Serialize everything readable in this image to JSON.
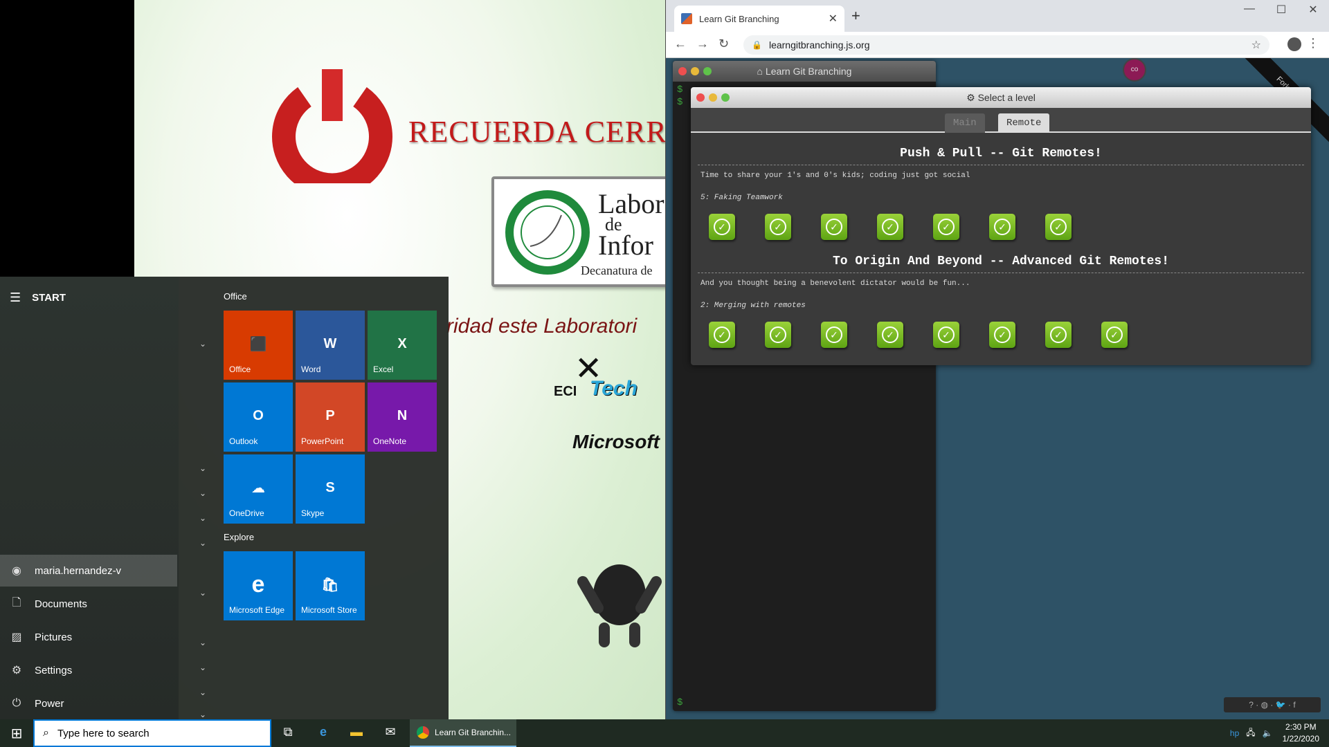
{
  "wallpaper": {
    "recuerda": "RECUERDA CERR",
    "lab_title_line1": "Labor",
    "lab_title_line2": "de",
    "lab_title_line3": "Infor",
    "lab_sub": "Decanatura de",
    "cuidado": "ridad este Laboratori",
    "ecitech": "Tech",
    "eci": "ECI",
    "microsoft": "Microsoft"
  },
  "chrome": {
    "tab_title": "Learn Git Branching",
    "url": "learngitbranching.js.org",
    "terminal_title": "Learn Git Branching",
    "avatar_initials": "co",
    "fork_ribbon": "Fork me",
    "level_window_title": "Select a level",
    "tabs": [
      "Main",
      "Remote"
    ],
    "sequences": [
      {
        "title": "Push & Pull -- Git Remotes!",
        "about": "Time to share your 1's and 0's kids; coding just got social",
        "current": "5: Faking Teamwork",
        "levels_completed": 7
      },
      {
        "title": "To Origin And Beyond -- Advanced Git Remotes!",
        "about": "And you thought being a benevolent dictator would be fun...",
        "current": "2: Merging with remotes",
        "levels_completed": 8
      }
    ]
  },
  "start_menu": {
    "header": "START",
    "user": "maria.hernandez-v",
    "nav": [
      "Documents",
      "Pictures",
      "Settings",
      "Power"
    ],
    "groups": [
      {
        "label": "Office",
        "tiles": [
          {
            "label": "Office",
            "icon": "office-icon",
            "color": "#d83b01"
          },
          {
            "label": "Word",
            "icon": "word-icon",
            "color": "#2b579a"
          },
          {
            "label": "Excel",
            "icon": "excel-icon",
            "color": "#217346"
          },
          {
            "label": "Outlook",
            "icon": "outlook-icon",
            "color": "#0078d4"
          },
          {
            "label": "PowerPoint",
            "icon": "powerpoint-icon",
            "color": "#d24726"
          },
          {
            "label": "OneNote",
            "icon": "onenote-icon",
            "color": "#7719aa"
          },
          {
            "label": "OneDrive",
            "icon": "onedrive-icon",
            "color": "#0078d4"
          },
          {
            "label": "Skype",
            "icon": "skype-icon",
            "color": "#0078d4"
          }
        ]
      },
      {
        "label": "Explore",
        "tiles": [
          {
            "label": "Microsoft Edge",
            "icon": "edge-icon",
            "color": "#0078d4"
          },
          {
            "label": "Microsoft Store",
            "icon": "store-icon",
            "color": "#0078d4"
          }
        ]
      }
    ]
  },
  "taskbar": {
    "search_placeholder": "Type here to search",
    "active_app": "Learn Git Branchin...",
    "time": "2:30 PM",
    "date": "1/22/2020"
  }
}
